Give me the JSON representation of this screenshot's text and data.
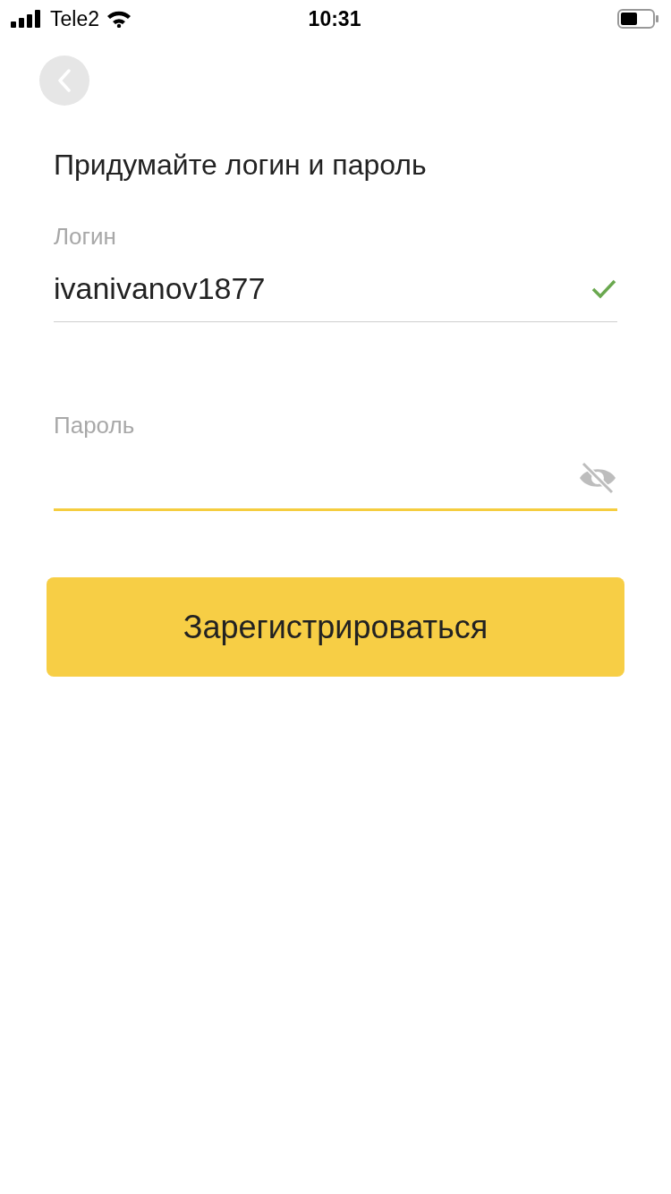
{
  "status_bar": {
    "carrier": "Tele2",
    "time": "10:31"
  },
  "title": "Придумайте логин и пароль",
  "fields": [
    {
      "kind": "text",
      "label": "Логин",
      "value": "ivanivanov1877",
      "focused": false,
      "valid": true
    },
    {
      "kind": "password",
      "label": "Пароль",
      "focused": true,
      "valid": false,
      "visible": false
    }
  ],
  "submit_button": "Зарегистрироваться"
}
